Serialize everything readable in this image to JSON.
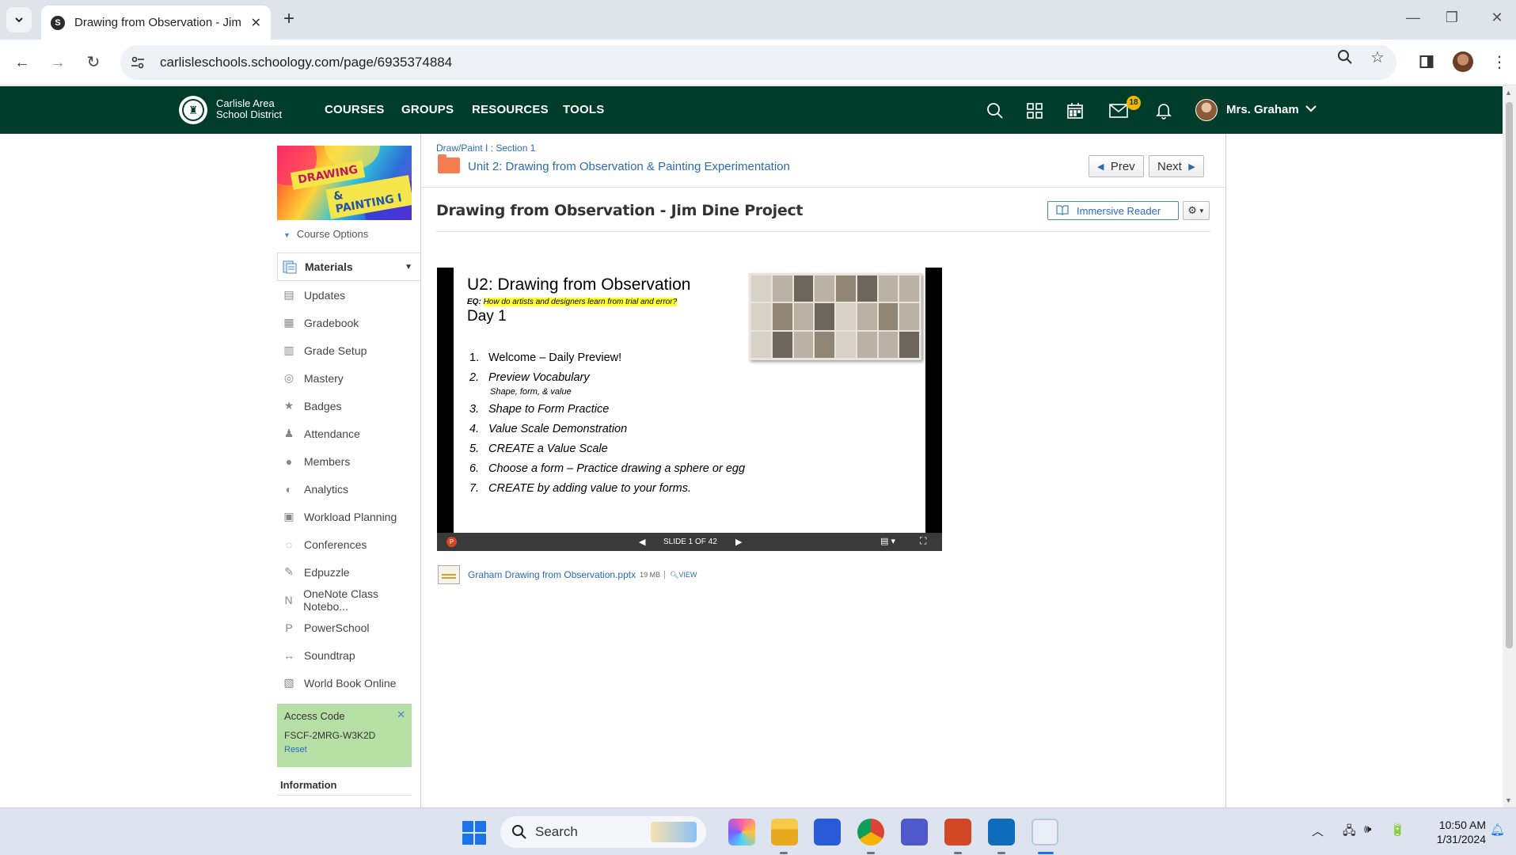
{
  "browser": {
    "tab_title": "Drawing from Observation - Jim",
    "favicon_letter": "S",
    "url": "carlisleschools.schoology.com/page/6935374884"
  },
  "header": {
    "district_line1": "Carlisle Area",
    "district_line2": "School District",
    "nav": [
      "COURSES",
      "GROUPS",
      "RESOURCES",
      "TOOLS"
    ],
    "messages_badge": "18",
    "user_name": "Mrs. Graham",
    "brand_color": "#003c2a"
  },
  "sidebar": {
    "course_image_line1": "DRAWING",
    "course_image_line2": "& PAINTING I",
    "course_options": "Course Options",
    "active_item": "Materials",
    "items": [
      {
        "label": "Updates",
        "icon": "updates-icon"
      },
      {
        "label": "Gradebook",
        "icon": "gradebook-icon"
      },
      {
        "label": "Grade Setup",
        "icon": "grade-setup-icon"
      },
      {
        "label": "Mastery",
        "icon": "mastery-icon"
      },
      {
        "label": "Badges",
        "icon": "badge-icon"
      },
      {
        "label": "Attendance",
        "icon": "attendance-icon"
      },
      {
        "label": "Members",
        "icon": "members-icon"
      },
      {
        "label": "Analytics",
        "icon": "analytics-icon"
      },
      {
        "label": "Workload Planning",
        "icon": "workload-icon"
      },
      {
        "label": "Conferences",
        "icon": "conferences-icon"
      },
      {
        "label": "Edpuzzle",
        "icon": "edpuzzle-icon"
      },
      {
        "label": "OneNote Class Notebo...",
        "icon": "onenote-icon"
      },
      {
        "label": "PowerSchool",
        "icon": "powerschool-icon"
      },
      {
        "label": "Soundtrap",
        "icon": "soundtrap-icon"
      },
      {
        "label": "World Book Online",
        "icon": "worldbook-icon"
      }
    ],
    "access_code_title": "Access Code",
    "access_code": "FSCF-2MRG-W3K2D",
    "access_reset": "Reset",
    "information": "Information"
  },
  "page": {
    "breadcrumb": "Draw/Paint I : Section 1",
    "unit_title": "Unit 2: Drawing from Observation & Painting Experimentation",
    "prev_label": "Prev",
    "next_label": "Next",
    "title": "Drawing from Observation - Jim Dine Project",
    "immersive_reader": "Immersive Reader"
  },
  "slide": {
    "title": "U2: Drawing from Observation",
    "eq_prefix": "EQ:",
    "eq_text": "How do artists and designers learn from trial and error?",
    "day": "Day 1",
    "items": [
      {
        "num": "1.",
        "text": "Welcome – Daily Preview!"
      },
      {
        "num": "2.",
        "text": "Preview Vocabulary"
      },
      {
        "num": "3.",
        "text": "Shape to Form Practice"
      },
      {
        "num": "4.",
        "text": "Value Scale Demonstration"
      },
      {
        "num": "5.",
        "text": "CREATE a Value Scale"
      },
      {
        "num": "6.",
        "text": "Choose a form – Practice drawing a sphere or egg"
      },
      {
        "num": "7.",
        "text": "CREATE by adding value to your forms."
      }
    ],
    "sub_note": "Shape, form, & value",
    "counter": "SLIDE 1 OF 42"
  },
  "attachment": {
    "name": "Graham Drawing from Observation.pptx",
    "size": "19 MB",
    "separator": "|",
    "view": "VIEW"
  },
  "taskbar": {
    "search_label": "Search",
    "time": "10:50 AM",
    "date": "1/31/2024"
  }
}
